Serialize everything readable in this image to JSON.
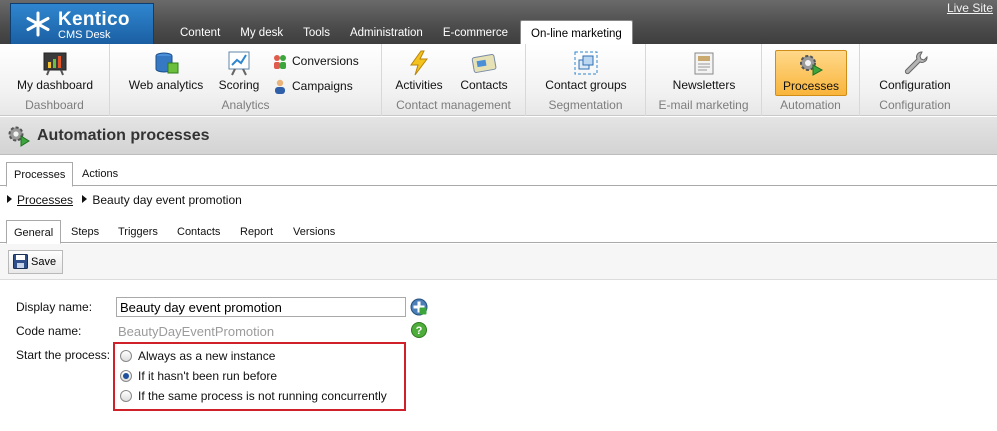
{
  "header": {
    "brand_title": "Kentico",
    "brand_sub": "CMS Desk",
    "tabs": [
      {
        "label": "Content"
      },
      {
        "label": "My desk"
      },
      {
        "label": "Tools"
      },
      {
        "label": "Administration"
      },
      {
        "label": "E-commerce"
      },
      {
        "label": "On-line marketing",
        "active": true
      }
    ],
    "live_site": "Live Site"
  },
  "ribbon": {
    "groups": [
      {
        "label": "Dashboard",
        "buttons": [
          {
            "label": "My dashboard",
            "icon": "chart-board-icon"
          }
        ]
      },
      {
        "label": "Analytics",
        "buttons": [
          {
            "label": "Web analytics",
            "icon": "database-icon"
          },
          {
            "label": "Scoring",
            "icon": "scoring-board-icon"
          },
          {
            "label": "Conversions",
            "icon": "people-icon"
          },
          {
            "label": "Campaigns",
            "icon": "user-icon"
          }
        ]
      },
      {
        "label": "Contact management",
        "buttons": [
          {
            "label": "Activities",
            "icon": "lightning-icon"
          },
          {
            "label": "Contacts",
            "icon": "contact-card-icon"
          }
        ]
      },
      {
        "label": "Segmentation",
        "buttons": [
          {
            "label": "Contact groups",
            "icon": "groups-icon"
          }
        ]
      },
      {
        "label": "E-mail marketing",
        "buttons": [
          {
            "label": "Newsletters",
            "icon": "newsletter-icon"
          }
        ]
      },
      {
        "label": "Automation",
        "buttons": [
          {
            "label": "Processes",
            "icon": "process-gears-icon",
            "selected": true
          }
        ]
      },
      {
        "label": "Configuration",
        "buttons": [
          {
            "label": "Configuration",
            "icon": "wrench-icon"
          }
        ]
      }
    ]
  },
  "page": {
    "title": "Automation processes",
    "tabs": [
      {
        "label": "Processes",
        "active": true
      },
      {
        "label": "Actions"
      }
    ],
    "breadcrumb": {
      "link": "Processes",
      "current": "Beauty day event promotion"
    },
    "subtabs": [
      {
        "label": "General",
        "active": true
      },
      {
        "label": "Steps"
      },
      {
        "label": "Triggers"
      },
      {
        "label": "Contacts"
      },
      {
        "label": "Report"
      },
      {
        "label": "Versions"
      }
    ],
    "save_label": "Save"
  },
  "form": {
    "display_name_label": "Display name:",
    "display_name_value": "Beauty day event promotion",
    "code_name_label": "Code name:",
    "code_name_value": "BeautyDayEventPromotion",
    "start_label": "Start the process:",
    "options": [
      {
        "label": "Always as a new instance",
        "checked": false
      },
      {
        "label": "If it hasn't been run before",
        "checked": true
      },
      {
        "label": "If the same process is not running concurrently",
        "checked": false
      }
    ]
  },
  "colors": {
    "accent": "#f9b53b",
    "brand": "#1b5fa3",
    "highlight_border": "#d0212b"
  }
}
